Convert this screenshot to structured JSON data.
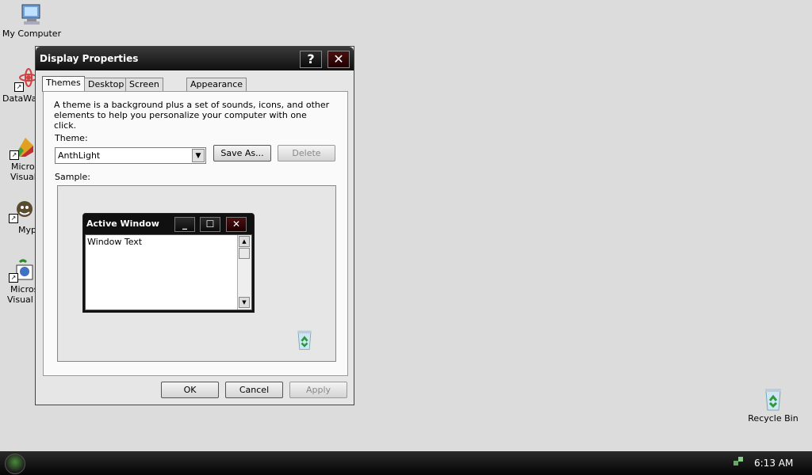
{
  "desktop": {
    "icons": [
      {
        "label": "My Computer",
        "icon": "computer-icon"
      },
      {
        "label": "DataWa",
        "icon": "atom-shortcut-icon"
      },
      {
        "label": "Micros",
        "label2": "Visual",
        "icon": "visual-studio-shortcut-icon"
      },
      {
        "label": "Myp",
        "icon": "app-shortcut-icon"
      },
      {
        "label": "Micros",
        "label2": "Visual I",
        "icon": "visual-studio-shortcut-icon"
      },
      {
        "label": "Recycle Bin",
        "icon": "recycle-bin-icon"
      }
    ]
  },
  "dialog": {
    "title": "Display Properties",
    "help_glyph": "?",
    "close_glyph": "✕",
    "tabs": [
      "Themes",
      "Desktop",
      "Screen Saver",
      "Appearance"
    ],
    "active_tab": "Themes",
    "description": "A theme is a background plus a set of sounds, icons, and other elements to help you personalize your computer with one click.",
    "theme_label": "Theme:",
    "theme_value": "AnthLight",
    "save_as_label": "Save As...",
    "delete_label": "Delete",
    "sample_label": "Sample:",
    "sample_window": {
      "title": "Active Window",
      "text": "Window Text"
    },
    "ok_label": "OK",
    "cancel_label": "Cancel",
    "apply_label": "Apply"
  },
  "taskbar": {
    "clock": "6:13 AM"
  },
  "colors": {
    "desktop": "#dcdcdc",
    "titlebar": "#101010",
    "taskbar": "#0a0a0a"
  }
}
